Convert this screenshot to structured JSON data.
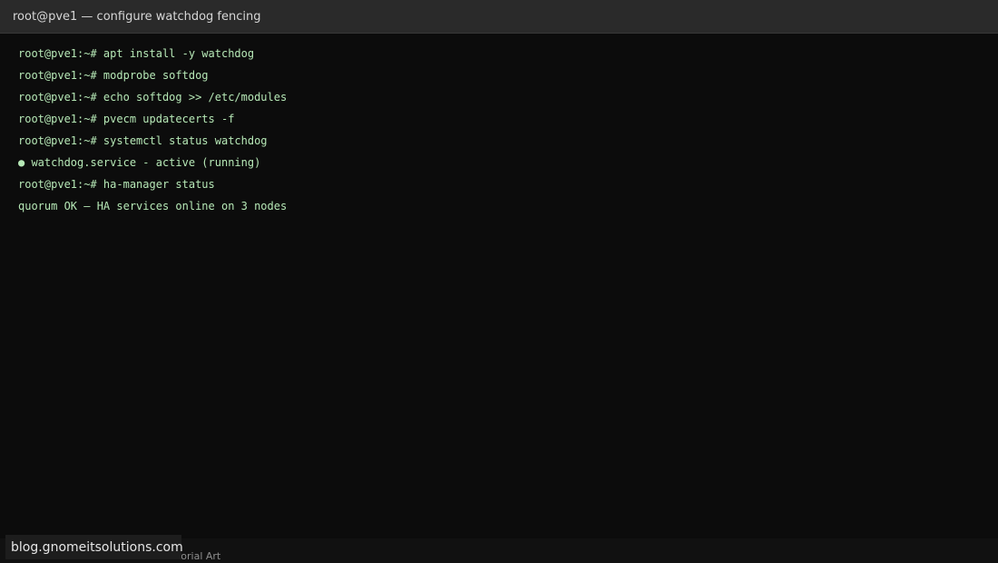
{
  "window": {
    "title": "root@pve1 — configure watchdog fencing"
  },
  "terminal": {
    "lines": [
      "root@pve1:~# apt install -y watchdog",
      "root@pve1:~# modprobe softdog",
      "root@pve1:~# echo softdog >> /etc/modules",
      "root@pve1:~# pvecm updatecerts -f",
      "root@pve1:~# systemctl status watchdog",
      "● watchdog.service - active (running)",
      "root@pve1:~# ha-manager status",
      "quorum OK — HA services online on 3 nodes"
    ]
  },
  "footer": {
    "caption": "utorial Art",
    "watermark": "blog.gnomeitsolutions.com"
  },
  "colors": {
    "terminal_bg": "#0c0c0c",
    "titlebar_bg": "#2a2a2a",
    "text_green": "#b6e8b6"
  }
}
